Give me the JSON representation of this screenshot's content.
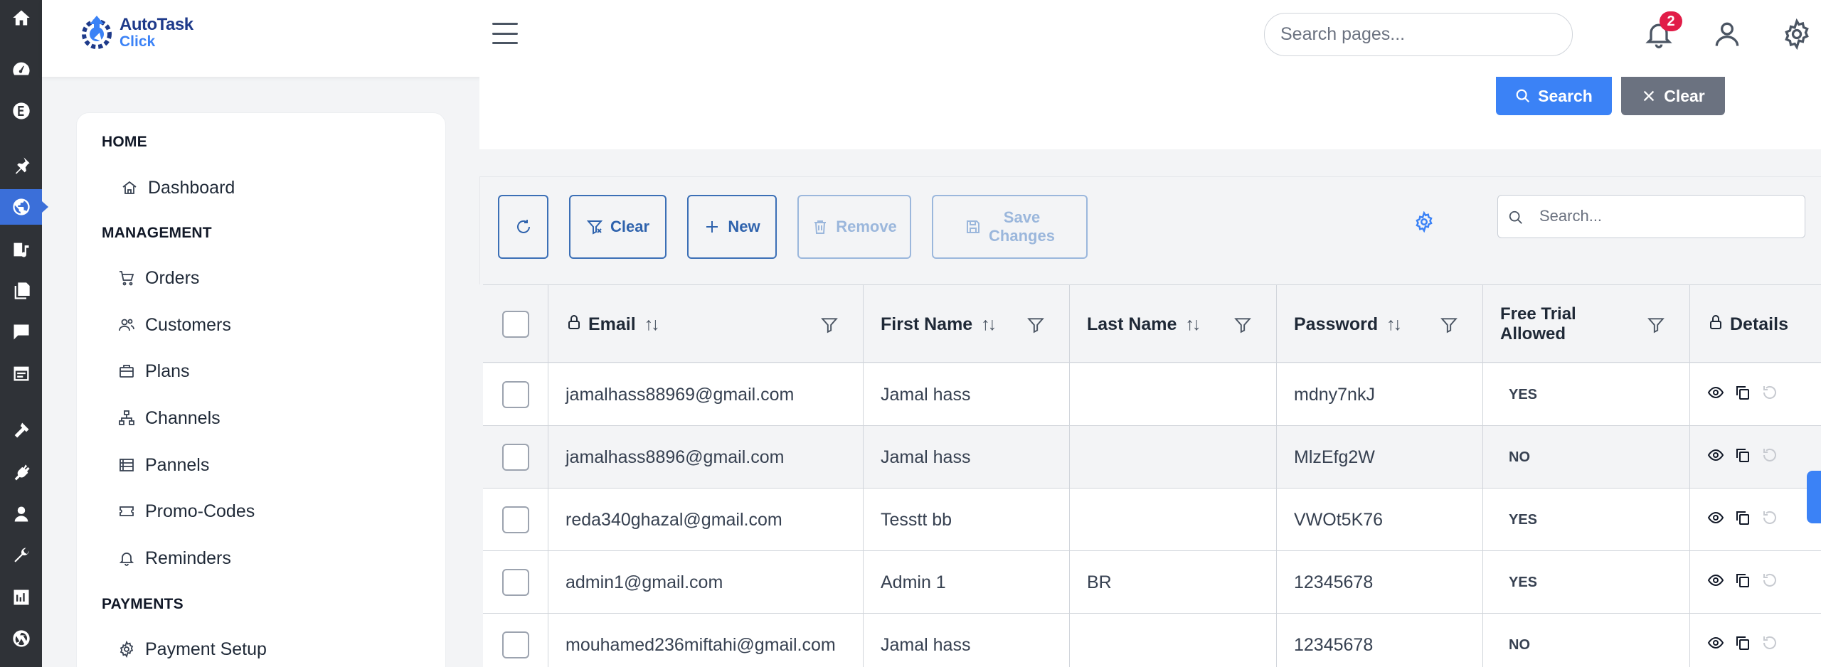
{
  "logo": {
    "line1": "AutoTask",
    "line2": "Click"
  },
  "header": {
    "search_placeholder": "Search pages...",
    "notification_count": "2"
  },
  "sidebar": {
    "sections": [
      {
        "title": "HOME",
        "items": [
          {
            "label": "Dashboard",
            "icon": "home-icon"
          }
        ]
      },
      {
        "title": "MANAGEMENT",
        "items": [
          {
            "label": "Orders",
            "icon": "cart-icon"
          },
          {
            "label": "Customers",
            "icon": "users-icon"
          },
          {
            "label": "Plans",
            "icon": "briefcase-icon"
          },
          {
            "label": "Channels",
            "icon": "hierarchy-icon"
          },
          {
            "label": "Pannels",
            "icon": "list-icon"
          },
          {
            "label": "Promo-Codes",
            "icon": "ticket-icon"
          },
          {
            "label": "Reminders",
            "icon": "bell-icon"
          }
        ]
      },
      {
        "title": "PAYMENTS",
        "items": [
          {
            "label": "Payment Setup",
            "icon": "gear-icon"
          }
        ]
      }
    ]
  },
  "search_panel": {
    "search_label": "Search",
    "clear_label": "Clear"
  },
  "toolbar": {
    "clear_label": "Clear",
    "new_label": "New",
    "remove_label": "Remove",
    "save_label_1": "Save",
    "save_label_2": "Changes",
    "search_placeholder": "Search..."
  },
  "table": {
    "columns": {
      "email": "Email",
      "first_name": "First Name",
      "last_name": "Last Name",
      "password": "Password",
      "free_trial_1": "Free Trial",
      "free_trial_2": "Allowed",
      "details": "Details"
    },
    "rows": [
      {
        "email": "jamalhass88969@gmail.com",
        "first_name": "Jamal hass",
        "last_name": "",
        "password": "mdny7nkJ",
        "free_trial": "YES"
      },
      {
        "email": "jamalhass8896@gmail.com",
        "first_name": "Jamal hass",
        "last_name": "",
        "password": "MlzEfg2W",
        "free_trial": "NO"
      },
      {
        "email": "reda340ghazal@gmail.com",
        "first_name": "Tesstt bb",
        "last_name": "",
        "password": "VWOt5K76",
        "free_trial": "YES"
      },
      {
        "email": "admin1@gmail.com",
        "first_name": "Admin 1",
        "last_name": "BR",
        "password": "12345678",
        "free_trial": "YES"
      },
      {
        "email": "mouhamed236miftahi@gmail.com",
        "first_name": "Jamal hass",
        "last_name": "",
        "password": "12345678",
        "free_trial": "NO"
      }
    ]
  },
  "colors": {
    "primary": "#3b82f6",
    "rail": "#2f3237",
    "badge": "#e11d48",
    "toolbar_border": "#3b6fb6"
  }
}
